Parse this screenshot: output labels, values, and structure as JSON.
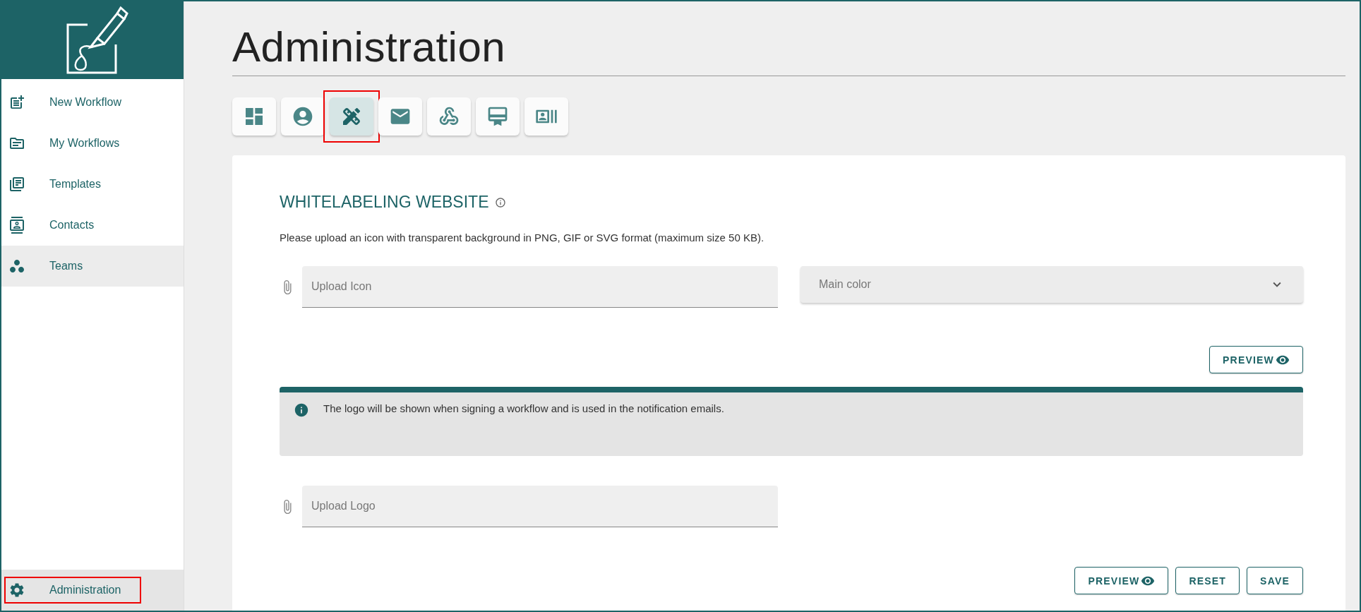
{
  "sidebar": {
    "items": [
      {
        "label": "New Workflow",
        "hovered": false
      },
      {
        "label": "My Workflows",
        "hovered": false
      },
      {
        "label": "Templates",
        "hovered": false
      },
      {
        "label": "Contacts",
        "hovered": false
      },
      {
        "label": "Teams",
        "hovered": true
      }
    ],
    "footer": {
      "label": "Administration",
      "selected": true,
      "annotated": true
    }
  },
  "page": {
    "title": "Administration"
  },
  "tabs": [
    {
      "selected": false,
      "annotated": false
    },
    {
      "selected": false,
      "annotated": false
    },
    {
      "selected": true,
      "annotated": true
    },
    {
      "selected": false,
      "annotated": false
    },
    {
      "selected": false,
      "annotated": false
    },
    {
      "selected": false,
      "annotated": false
    },
    {
      "selected": false,
      "annotated": false
    }
  ],
  "card": {
    "heading": "WHITELABELING WEBSITE",
    "description": "Please upload an icon with transparent background in PNG, GIF or SVG format (maximum size 50 KB).",
    "icon_upload": {
      "placeholder": "Upload Icon"
    },
    "main_color": {
      "placeholder": "Main color"
    },
    "preview_button": "PREVIEW",
    "info": "The logo will be shown when signing a workflow and is used in the notification emails.",
    "logo_upload": {
      "placeholder": "Upload Logo"
    },
    "buttons": [
      "PREVIEW",
      "RESET",
      "SAVE"
    ]
  }
}
